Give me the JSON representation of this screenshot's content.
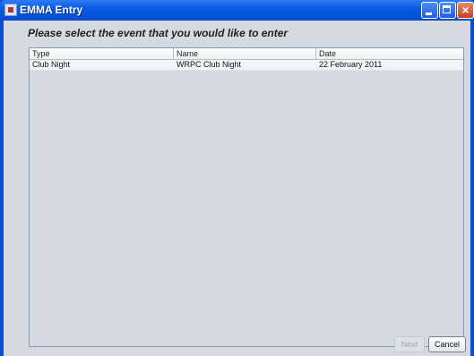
{
  "window": {
    "title": "EMMA Entry",
    "controls": [
      "minimize-icon",
      "maximize-icon",
      "close-icon"
    ]
  },
  "heading": "Please select the event that you would like to enter",
  "table": {
    "columns": [
      "Type",
      "Name",
      "Date"
    ],
    "rows": [
      [
        "Club Night",
        "WRPC Club Night",
        "22 February 2011"
      ]
    ]
  },
  "buttons": {
    "next_label": "Next",
    "next_enabled": false,
    "cancel_label": "Cancel"
  },
  "colors": {
    "titlebar": "#0a5ae6",
    "client_bg": "#d6d9df",
    "selected_row": "#f3f4f6"
  }
}
